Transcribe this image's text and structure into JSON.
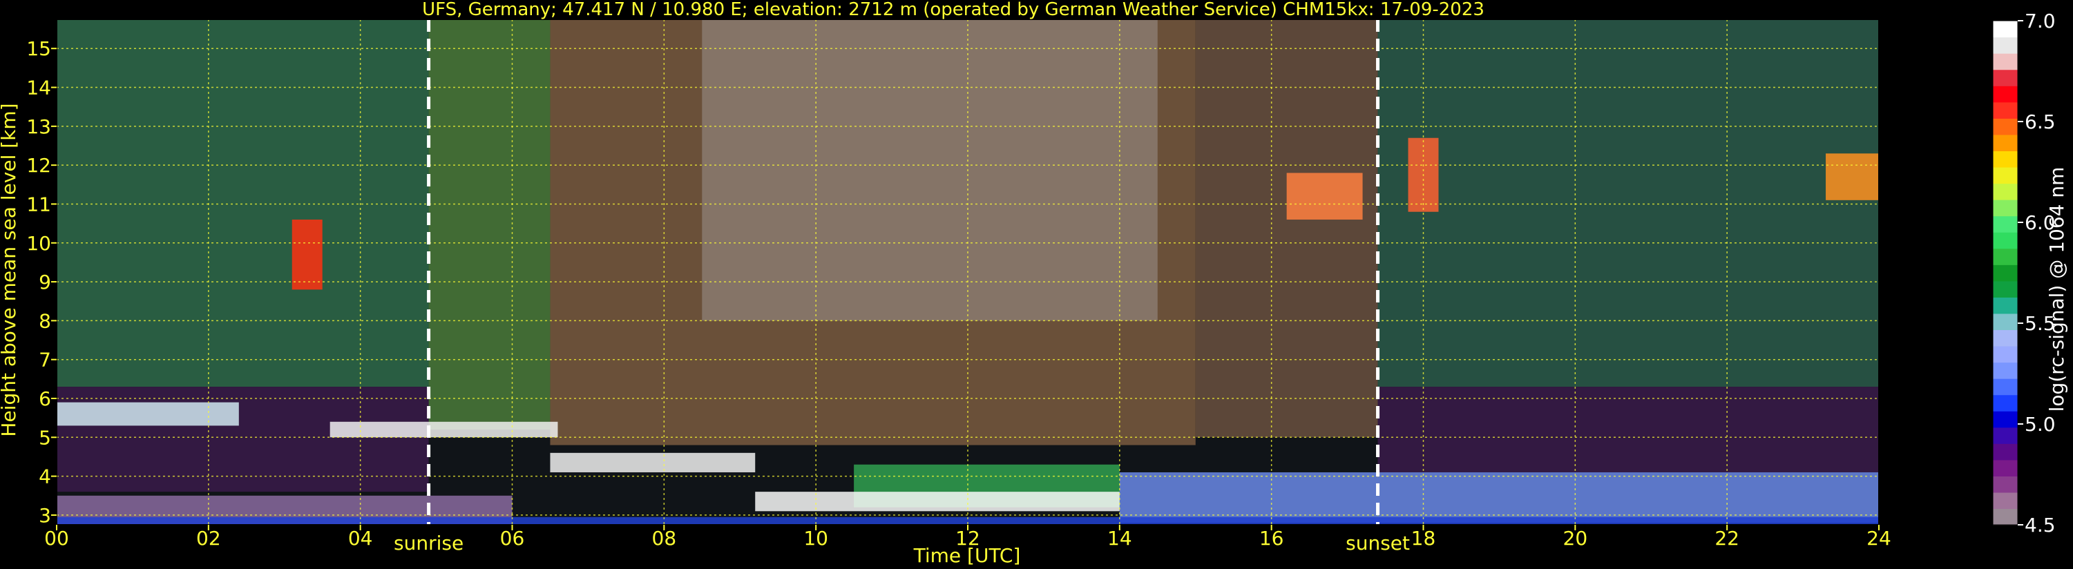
{
  "chart_data": {
    "type": "heatmap",
    "title": "UFS, Germany; 47.417 N / 10.980 E; elevation: 2712 m  (operated by German Weather Service)    CHM15kx: 17-09-2023",
    "xlabel": "Time [UTC]",
    "ylabel": "Height above mean sea level [km]",
    "xlim": [
      0,
      24
    ],
    "ylim": [
      2.75,
      15.75
    ],
    "x_ticks": [
      {
        "value": 0,
        "label": "00"
      },
      {
        "value": 2,
        "label": "02"
      },
      {
        "value": 4,
        "label": "04"
      },
      {
        "value": 6,
        "label": "06"
      },
      {
        "value": 8,
        "label": "08"
      },
      {
        "value": 10,
        "label": "10"
      },
      {
        "value": 12,
        "label": "12"
      },
      {
        "value": 14,
        "label": "14"
      },
      {
        "value": 16,
        "label": "16"
      },
      {
        "value": 18,
        "label": "18"
      },
      {
        "value": 20,
        "label": "20"
      },
      {
        "value": 22,
        "label": "22"
      },
      {
        "value": 24,
        "label": "24"
      }
    ],
    "y_ticks": [
      {
        "value": 3,
        "label": "3"
      },
      {
        "value": 4,
        "label": "4"
      },
      {
        "value": 5,
        "label": "5"
      },
      {
        "value": 6,
        "label": "6"
      },
      {
        "value": 7,
        "label": "7"
      },
      {
        "value": 8,
        "label": "8"
      },
      {
        "value": 9,
        "label": "9"
      },
      {
        "value": 10,
        "label": "10"
      },
      {
        "value": 11,
        "label": "11"
      },
      {
        "value": 12,
        "label": "12"
      },
      {
        "value": 13,
        "label": "13"
      },
      {
        "value": 14,
        "label": "14"
      },
      {
        "value": 15,
        "label": "15"
      }
    ],
    "grid": true,
    "grid_color": "#ffff33",
    "markers": [
      {
        "label": "sunrise",
        "time": 4.9
      },
      {
        "label": "sunset",
        "time": 17.4
      }
    ],
    "colorbar": {
      "label": "log(rc-signal) @ 1064 nm",
      "range": [
        4.5,
        7.0
      ],
      "ticks": [
        {
          "value": 4.5,
          "label": "4.5"
        },
        {
          "value": 5.0,
          "label": "5.0"
        },
        {
          "value": 5.5,
          "label": "5.5"
        },
        {
          "value": 6.0,
          "label": "6.0"
        },
        {
          "value": 6.5,
          "label": "6.5"
        },
        {
          "value": 7.0,
          "label": "7.0"
        }
      ],
      "colors": [
        "#9a8a96",
        "#a0739a",
        "#8a3d8e",
        "#7a1a8a",
        "#5a0a8a",
        "#3a0ab0",
        "#0000d8",
        "#1a40ff",
        "#4a70ff",
        "#7a96ff",
        "#9aaaff",
        "#a8b8f8",
        "#7fc4cc",
        "#20b090",
        "#10a040",
        "#109a28",
        "#30c040",
        "#30dc60",
        "#48e878",
        "#88ee60",
        "#c8f640",
        "#f0f020",
        "#ffd800",
        "#ff9a00",
        "#ff6a10",
        "#ff3020",
        "#ff0010",
        "#e83040",
        "#f0c0c0",
        "#e8e8e8",
        "#ffffff"
      ]
    },
    "regions": [
      {
        "name": "noise-night-early",
        "t0": 0,
        "t1": 4.9,
        "h0": 6.3,
        "h1": 15.75,
        "color": "#2e6a4a"
      },
      {
        "name": "noise-dawn",
        "t0": 4.9,
        "t1": 6.5,
        "h0": 5.2,
        "h1": 15.75,
        "color": "#4a7a3a"
      },
      {
        "name": "noise-day",
        "t0": 6.5,
        "t1": 15.0,
        "h0": 4.8,
        "h1": 15.75,
        "color": "#7a5a40"
      },
      {
        "name": "noise-day-bright",
        "t0": 8.5,
        "t1": 14.5,
        "h0": 8.0,
        "h1": 15.75,
        "color": "#8a7a70"
      },
      {
        "name": "noise-afternoon",
        "t0": 15.0,
        "t1": 17.4,
        "h0": 5.0,
        "h1": 15.75,
        "color": "#6a5040"
      },
      {
        "name": "noise-night-late",
        "t0": 17.4,
        "t1": 24,
        "h0": 6.3,
        "h1": 15.75,
        "color": "#2a5a4a"
      },
      {
        "name": "mid-purple-early",
        "t0": 0,
        "t1": 4.9,
        "h0": 3.6,
        "h1": 6.3,
        "color": "#3a1a4a"
      },
      {
        "name": "mid-purple-late",
        "t0": 17.4,
        "t1": 24,
        "h0": 4.1,
        "h1": 6.3,
        "color": "#3a1a4a"
      },
      {
        "name": "boundary-layer-morning",
        "t0": 0,
        "t1": 6.0,
        "h0": 2.75,
        "h1": 3.5,
        "color": "#8a6aa0"
      },
      {
        "name": "boundary-layer-day",
        "t0": 10.5,
        "t1": 14.0,
        "h0": 3.2,
        "h1": 4.3,
        "color": "#30a050"
      },
      {
        "name": "boundary-layer-evening",
        "t0": 14.0,
        "t1": 24,
        "h0": 2.8,
        "h1": 4.1,
        "color": "#6a88e8"
      },
      {
        "name": "ground-band",
        "t0": 0,
        "t1": 24,
        "h0": 2.75,
        "h1": 2.95,
        "color": "#2040d0"
      },
      {
        "name": "cloud-layer-early",
        "t0": 0,
        "t1": 2.4,
        "h0": 5.3,
        "h1": 5.9,
        "color": "#d0e8f0"
      },
      {
        "name": "cloud-layer-morning",
        "t0": 3.6,
        "t1": 6.6,
        "h0": 5.0,
        "h1": 5.4,
        "color": "#f0f0f0"
      },
      {
        "name": "cloud-low-morning",
        "t0": 6.5,
        "t1": 9.2,
        "h0": 4.1,
        "h1": 4.6,
        "color": "#f0f0f0"
      },
      {
        "name": "cloud-low-day",
        "t0": 9.2,
        "t1": 14.0,
        "h0": 3.1,
        "h1": 3.6,
        "color": "#f8f8f8"
      },
      {
        "name": "cirrus-1",
        "t0": 3.1,
        "t1": 3.5,
        "h0": 8.8,
        "h1": 10.6,
        "color": "#ff3010"
      },
      {
        "name": "cirrus-2",
        "t0": 16.2,
        "t1": 17.2,
        "h0": 10.6,
        "h1": 11.8,
        "color": "#ff8040"
      },
      {
        "name": "cirrus-3",
        "t0": 17.8,
        "t1": 18.2,
        "h0": 10.8,
        "h1": 12.7,
        "color": "#ff6030"
      },
      {
        "name": "cirrus-4",
        "t0": 23.3,
        "t1": 24,
        "h0": 11.1,
        "h1": 12.3,
        "color": "#ff9020"
      }
    ]
  }
}
